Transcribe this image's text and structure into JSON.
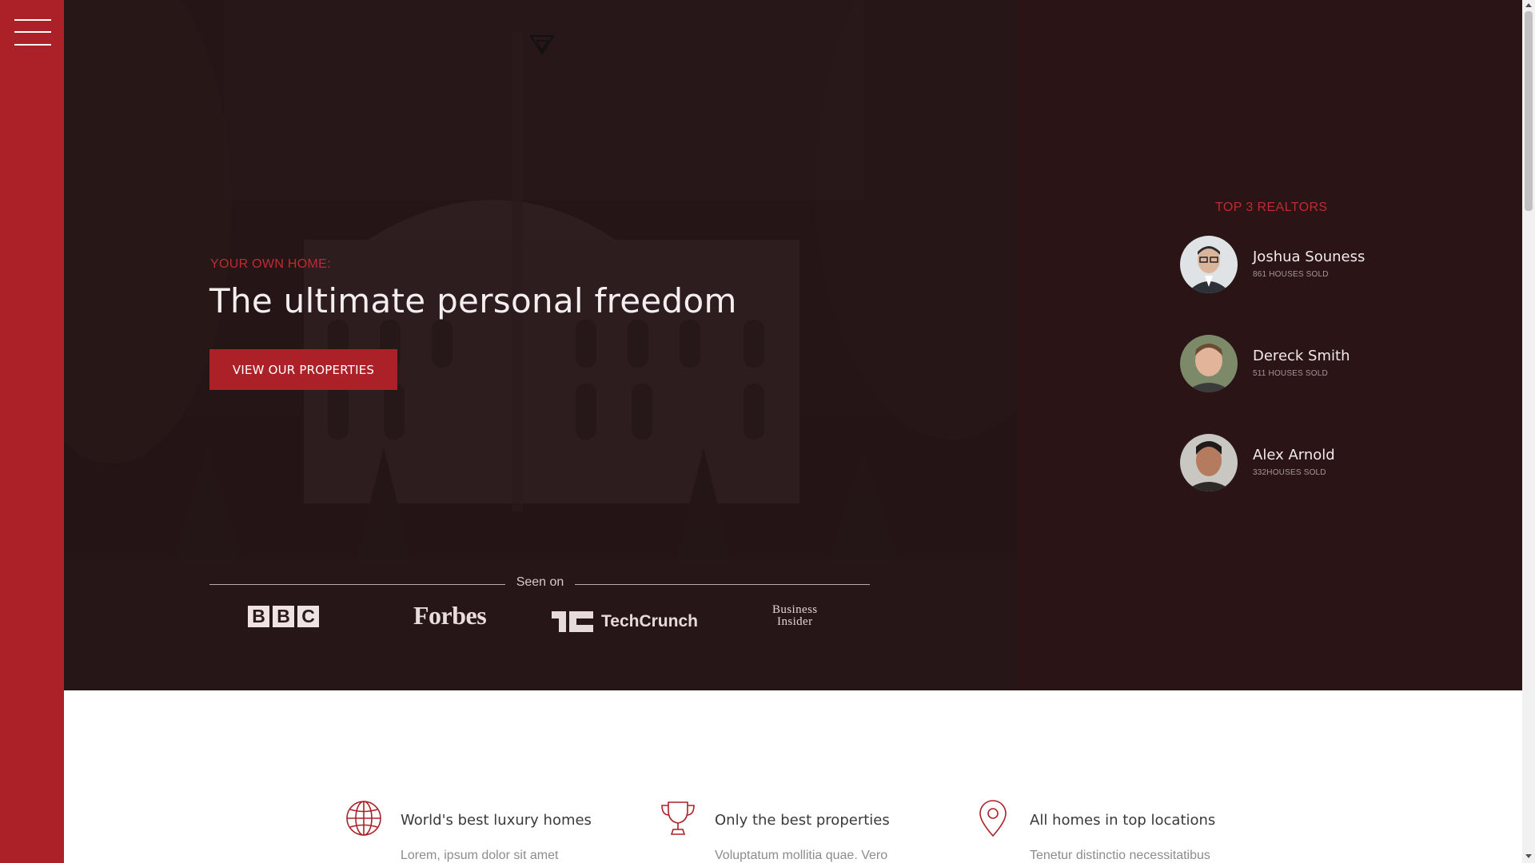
{
  "nav": {
    "menu_icon": "hamburger-icon"
  },
  "brand": {
    "logo_icon": "triangle-logo-icon",
    "accent": "#ac2127"
  },
  "hero": {
    "eyebrow": "YOUR OWN HOME:",
    "headline": "The ultimate personal freedom",
    "cta_label": "VIEW OUR PROPERTIES",
    "seen_on_label": "Seen on",
    "press": {
      "bbc": [
        "B",
        "B",
        "C"
      ],
      "forbes": "Forbes",
      "techcrunch": "TechCrunch",
      "business_insider_line1": "Business",
      "business_insider_line2": "Insider"
    }
  },
  "realtors": {
    "heading": "TOP 3 REALTORS",
    "items": [
      {
        "name": "Joshua Souness",
        "sold": "861 HOUSES SOLD"
      },
      {
        "name": "Dereck Smith",
        "sold": "511 HOUSES SOLD"
      },
      {
        "name": "Alex Arnold",
        "sold": "332HOUSES SOLD"
      }
    ]
  },
  "features": [
    {
      "icon": "globe-icon",
      "title": "World's best luxury homes",
      "text": "Lorem, ipsum dolor sit amet"
    },
    {
      "icon": "trophy-icon",
      "title": "Only the best properties",
      "text": "Voluptatum mollitia quae. Vero"
    },
    {
      "icon": "map-pin-icon",
      "title": "All homes in top locations",
      "text": "Tenetur distinctio necessitatibus"
    }
  ]
}
